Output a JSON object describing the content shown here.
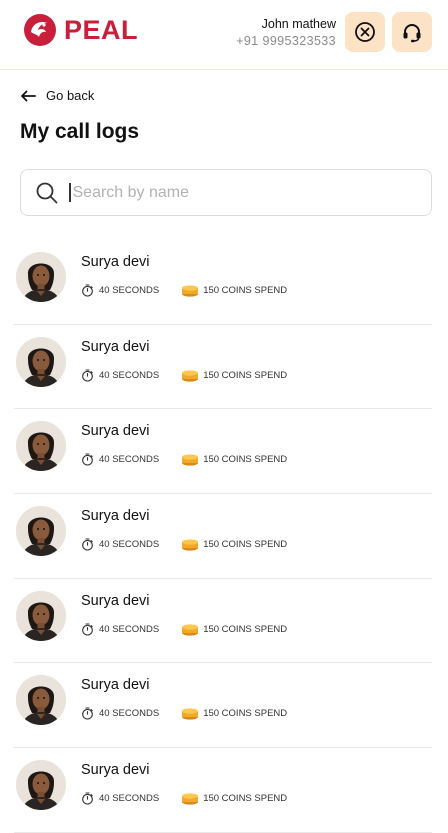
{
  "header": {
    "brand": "PEAL",
    "user_name": "John mathew",
    "user_phone": "+91 9995323533"
  },
  "nav": {
    "back_label": "Go back"
  },
  "page": {
    "title": "My call logs"
  },
  "search": {
    "placeholder": "Search by name",
    "value": ""
  },
  "calls": [
    {
      "name": "Surya devi",
      "duration": "40 SECONDS",
      "coins": "150 COINS SPEND"
    },
    {
      "name": "Surya devi",
      "duration": "40 SECONDS",
      "coins": "150 COINS SPEND"
    },
    {
      "name": "Surya devi",
      "duration": "40 SECONDS",
      "coins": "150 COINS SPEND"
    },
    {
      "name": "Surya devi",
      "duration": "40 SECONDS",
      "coins": "150 COINS SPEND"
    },
    {
      "name": "Surya devi",
      "duration": "40 SECONDS",
      "coins": "150 COINS SPEND"
    },
    {
      "name": "Surya devi",
      "duration": "40 SECONDS",
      "coins": "150 COINS SPEND"
    },
    {
      "name": "Surya devi",
      "duration": "40 SECONDS",
      "coins": "150 COINS SPEND"
    }
  ],
  "colors": {
    "brand": "#c81f3a",
    "button_bg": "#fce3c6",
    "coin": "#f0a92b"
  },
  "icons": [
    "peal-logo-icon",
    "close-circle-icon",
    "headset-icon",
    "arrow-left-icon",
    "search-icon",
    "stopwatch-icon",
    "coin-stack-icon"
  ]
}
